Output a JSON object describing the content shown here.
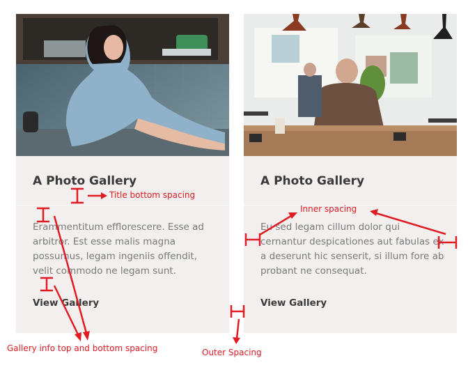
{
  "cards": [
    {
      "title": "A Photo Gallery",
      "description": "Erammentitum efflorescere. Esse ad arbitror. Est esse malis magna possumus, legam ingeniis offendit, velit commodo ne legam sunt.",
      "cta": "View Gallery"
    },
    {
      "title": "A Photo Gallery",
      "description": "Eu sed legam cillum dolor qui cernantur despicationes aut fabulas ex a deserunt hic senserit, si illum fore ab probant ne consequat.",
      "cta": "View Gallery"
    }
  ],
  "annotations": {
    "title_bottom_spacing": "Title bottom spacing",
    "inner_spacing": "Inner spacing",
    "gallery_info_spacing": "Gallery info top and bottom spacing",
    "outer_spacing": "Outer Spacing"
  },
  "colors": {
    "card_background": "#f3efee",
    "annotation": "#e11b22",
    "title": "#3a3a3a",
    "body_text": "#7a7a7a"
  }
}
